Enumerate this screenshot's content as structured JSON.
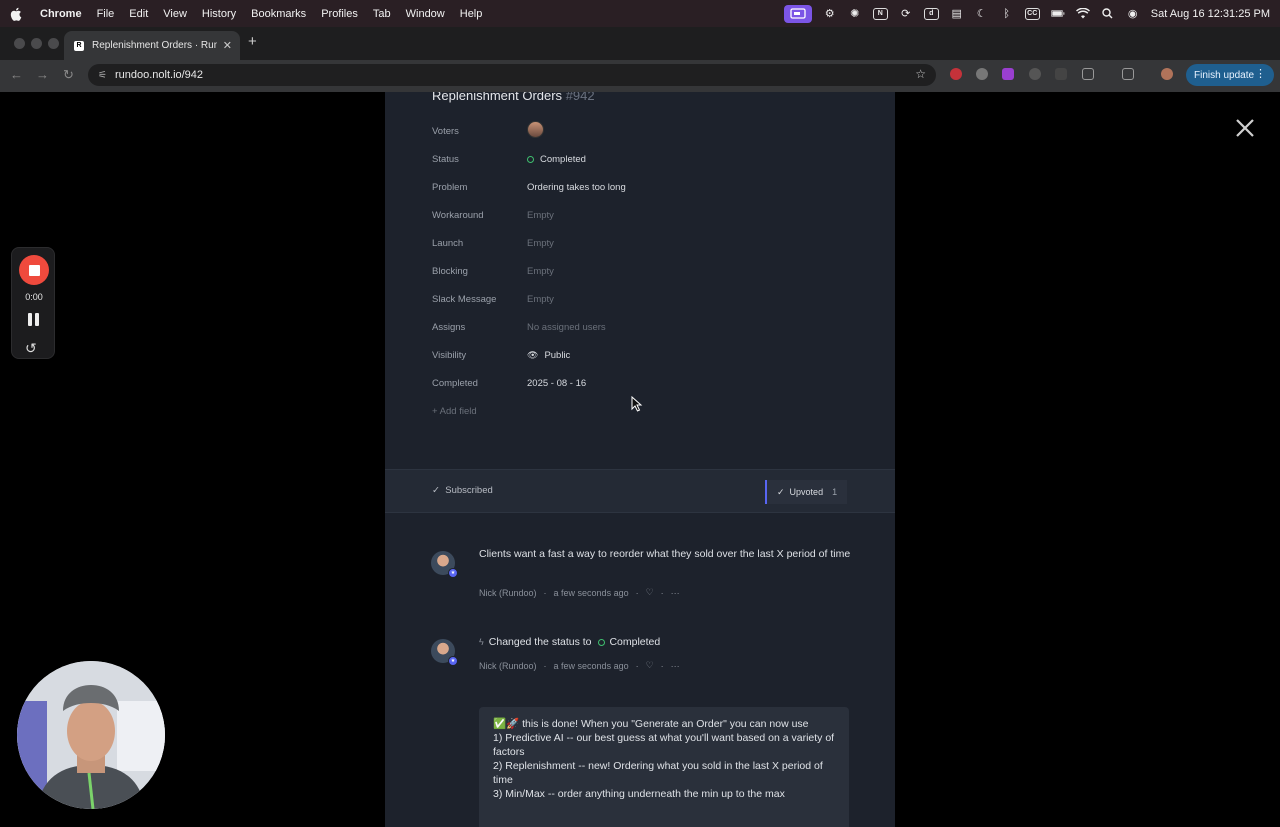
{
  "menubar": {
    "app": "Chrome",
    "items": [
      "File",
      "Edit",
      "View",
      "History",
      "Bookmarks",
      "Profiles",
      "Tab",
      "Window",
      "Help"
    ],
    "cc_label": "CC",
    "clock": "Sat Aug 16  12:31:25 PM"
  },
  "browser": {
    "tab_title": "Replenishment Orders · Rund",
    "tab_favicon": "R",
    "url": "rundoo.nolt.io/942",
    "finish_update": "Finish update"
  },
  "post": {
    "title": "Replenishment Orders",
    "number": "#942",
    "fields": [
      {
        "label": "Voters",
        "value": "",
        "kind": "avatar"
      },
      {
        "label": "Status",
        "value": "Completed",
        "kind": "status"
      },
      {
        "label": "Problem",
        "value": "Ordering takes too long",
        "kind": "text"
      },
      {
        "label": "Workaround",
        "value": "Empty",
        "kind": "empty"
      },
      {
        "label": "Launch",
        "value": "Empty",
        "kind": "empty"
      },
      {
        "label": "Blocking",
        "value": "Empty",
        "kind": "empty"
      },
      {
        "label": "Slack Message",
        "value": "Empty",
        "kind": "empty"
      },
      {
        "label": "Assigns",
        "value": "No assigned users",
        "kind": "empty"
      },
      {
        "label": "Visibility",
        "value": "Public",
        "kind": "visibility"
      },
      {
        "label": "Completed",
        "value": "2025 - 08 - 16",
        "kind": "text"
      }
    ],
    "add_field": "+ Add field",
    "subscribed": "Subscribed",
    "upvoted": "Upvoted",
    "upvote_count": "1"
  },
  "activity": [
    {
      "text": "Clients want a fast a way to reorder what they sold over the last X period of time",
      "author": "Nick (Rundoo)",
      "time": "a few seconds ago"
    },
    {
      "prefix": "Changed the status to",
      "status": "Completed",
      "author": "Nick (Rundoo)",
      "time": "a few seconds ago"
    }
  ],
  "comment_lines": [
    "✅🚀 this is done! When you \"Generate an Order\" you can now use",
    "1) Predictive AI -- our best guess at what you'll want based on a variety of factors",
    "2) Replenishment -- new! Ordering what you sold in the last X period of time",
    "3) Min/Max -- order anything underneath the min up to the max"
  ],
  "recorder": {
    "time": "0:00"
  },
  "colors": {
    "accent": "#5865f2",
    "status_green": "#3fbf6f",
    "record_red": "#ef4a3d"
  }
}
